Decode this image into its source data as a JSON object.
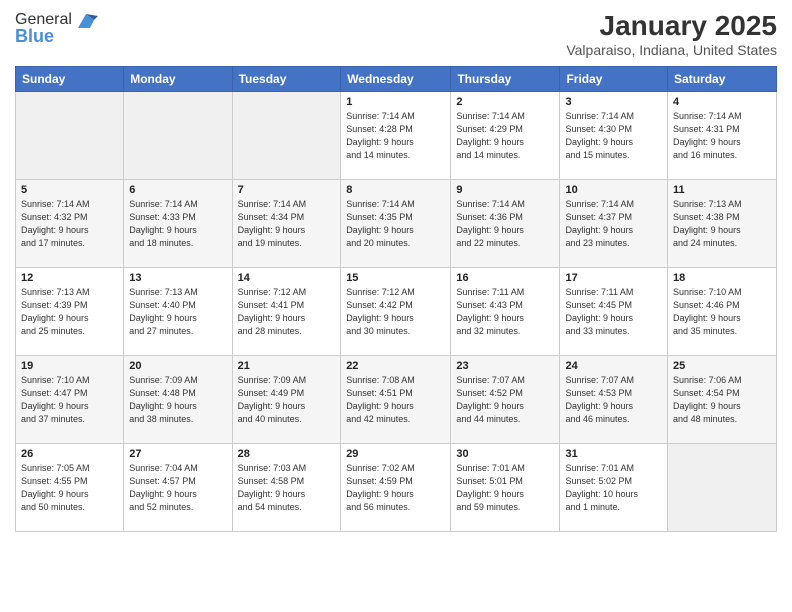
{
  "logo": {
    "general": "General",
    "blue": "Blue"
  },
  "title": "January 2025",
  "subtitle": "Valparaiso, Indiana, United States",
  "weekdays": [
    "Sunday",
    "Monday",
    "Tuesday",
    "Wednesday",
    "Thursday",
    "Friday",
    "Saturday"
  ],
  "weeks": [
    [
      {
        "day": "",
        "info": ""
      },
      {
        "day": "",
        "info": ""
      },
      {
        "day": "",
        "info": ""
      },
      {
        "day": "1",
        "info": "Sunrise: 7:14 AM\nSunset: 4:28 PM\nDaylight: 9 hours\nand 14 minutes."
      },
      {
        "day": "2",
        "info": "Sunrise: 7:14 AM\nSunset: 4:29 PM\nDaylight: 9 hours\nand 14 minutes."
      },
      {
        "day": "3",
        "info": "Sunrise: 7:14 AM\nSunset: 4:30 PM\nDaylight: 9 hours\nand 15 minutes."
      },
      {
        "day": "4",
        "info": "Sunrise: 7:14 AM\nSunset: 4:31 PM\nDaylight: 9 hours\nand 16 minutes."
      }
    ],
    [
      {
        "day": "5",
        "info": "Sunrise: 7:14 AM\nSunset: 4:32 PM\nDaylight: 9 hours\nand 17 minutes."
      },
      {
        "day": "6",
        "info": "Sunrise: 7:14 AM\nSunset: 4:33 PM\nDaylight: 9 hours\nand 18 minutes."
      },
      {
        "day": "7",
        "info": "Sunrise: 7:14 AM\nSunset: 4:34 PM\nDaylight: 9 hours\nand 19 minutes."
      },
      {
        "day": "8",
        "info": "Sunrise: 7:14 AM\nSunset: 4:35 PM\nDaylight: 9 hours\nand 20 minutes."
      },
      {
        "day": "9",
        "info": "Sunrise: 7:14 AM\nSunset: 4:36 PM\nDaylight: 9 hours\nand 22 minutes."
      },
      {
        "day": "10",
        "info": "Sunrise: 7:14 AM\nSunset: 4:37 PM\nDaylight: 9 hours\nand 23 minutes."
      },
      {
        "day": "11",
        "info": "Sunrise: 7:13 AM\nSunset: 4:38 PM\nDaylight: 9 hours\nand 24 minutes."
      }
    ],
    [
      {
        "day": "12",
        "info": "Sunrise: 7:13 AM\nSunset: 4:39 PM\nDaylight: 9 hours\nand 25 minutes."
      },
      {
        "day": "13",
        "info": "Sunrise: 7:13 AM\nSunset: 4:40 PM\nDaylight: 9 hours\nand 27 minutes."
      },
      {
        "day": "14",
        "info": "Sunrise: 7:12 AM\nSunset: 4:41 PM\nDaylight: 9 hours\nand 28 minutes."
      },
      {
        "day": "15",
        "info": "Sunrise: 7:12 AM\nSunset: 4:42 PM\nDaylight: 9 hours\nand 30 minutes."
      },
      {
        "day": "16",
        "info": "Sunrise: 7:11 AM\nSunset: 4:43 PM\nDaylight: 9 hours\nand 32 minutes."
      },
      {
        "day": "17",
        "info": "Sunrise: 7:11 AM\nSunset: 4:45 PM\nDaylight: 9 hours\nand 33 minutes."
      },
      {
        "day": "18",
        "info": "Sunrise: 7:10 AM\nSunset: 4:46 PM\nDaylight: 9 hours\nand 35 minutes."
      }
    ],
    [
      {
        "day": "19",
        "info": "Sunrise: 7:10 AM\nSunset: 4:47 PM\nDaylight: 9 hours\nand 37 minutes."
      },
      {
        "day": "20",
        "info": "Sunrise: 7:09 AM\nSunset: 4:48 PM\nDaylight: 9 hours\nand 38 minutes."
      },
      {
        "day": "21",
        "info": "Sunrise: 7:09 AM\nSunset: 4:49 PM\nDaylight: 9 hours\nand 40 minutes."
      },
      {
        "day": "22",
        "info": "Sunrise: 7:08 AM\nSunset: 4:51 PM\nDaylight: 9 hours\nand 42 minutes."
      },
      {
        "day": "23",
        "info": "Sunrise: 7:07 AM\nSunset: 4:52 PM\nDaylight: 9 hours\nand 44 minutes."
      },
      {
        "day": "24",
        "info": "Sunrise: 7:07 AM\nSunset: 4:53 PM\nDaylight: 9 hours\nand 46 minutes."
      },
      {
        "day": "25",
        "info": "Sunrise: 7:06 AM\nSunset: 4:54 PM\nDaylight: 9 hours\nand 48 minutes."
      }
    ],
    [
      {
        "day": "26",
        "info": "Sunrise: 7:05 AM\nSunset: 4:55 PM\nDaylight: 9 hours\nand 50 minutes."
      },
      {
        "day": "27",
        "info": "Sunrise: 7:04 AM\nSunset: 4:57 PM\nDaylight: 9 hours\nand 52 minutes."
      },
      {
        "day": "28",
        "info": "Sunrise: 7:03 AM\nSunset: 4:58 PM\nDaylight: 9 hours\nand 54 minutes."
      },
      {
        "day": "29",
        "info": "Sunrise: 7:02 AM\nSunset: 4:59 PM\nDaylight: 9 hours\nand 56 minutes."
      },
      {
        "day": "30",
        "info": "Sunrise: 7:01 AM\nSunset: 5:01 PM\nDaylight: 9 hours\nand 59 minutes."
      },
      {
        "day": "31",
        "info": "Sunrise: 7:01 AM\nSunset: 5:02 PM\nDaylight: 10 hours\nand 1 minute."
      },
      {
        "day": "",
        "info": ""
      }
    ]
  ]
}
